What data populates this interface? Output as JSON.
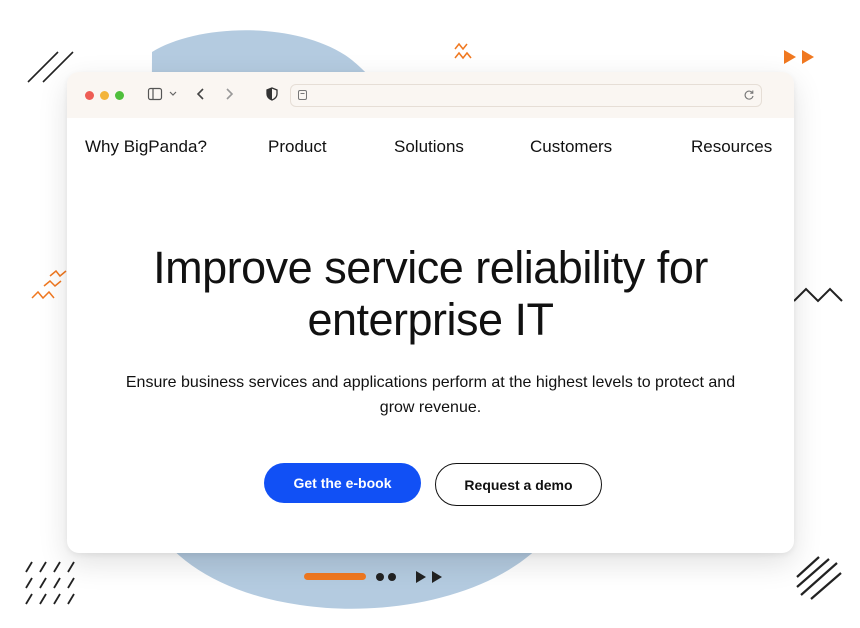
{
  "colors": {
    "accent_orange": "#f07820",
    "primary_blue": "#1150f5",
    "blob_blue": "#b4cbe0",
    "text": "#111111"
  },
  "browser": {
    "icons": [
      "sidebar-icon",
      "chevron-down-icon",
      "back-icon",
      "forward-icon",
      "shield-icon",
      "page-icon",
      "reload-icon"
    ],
    "url": ""
  },
  "nav": {
    "items": [
      {
        "label": "Why BigPanda?"
      },
      {
        "label": "Product"
      },
      {
        "label": "Solutions"
      },
      {
        "label": "Customers"
      },
      {
        "label": "Resources"
      }
    ]
  },
  "hero": {
    "title": "Improve service reliability for\nenterprise IT",
    "subtitle": "Ensure business services and applications perform at the highest levels to protect and\ngrow revenue.",
    "primary_cta": "Get the e-book",
    "secondary_cta": "Request a demo"
  }
}
